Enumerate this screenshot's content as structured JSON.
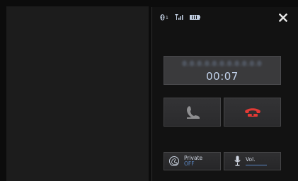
{
  "status_bar": {
    "bluetooth_icon": "bluetooth-icon",
    "bluetooth_index": "1",
    "signal_icon": "signal-strength-icon",
    "battery_icon": "battery-icon"
  },
  "close_icon": "close-icon",
  "call": {
    "caller_number": "0.0.0.0.0.0.0.0.0.0.0",
    "duration": "00:07"
  },
  "buttons": {
    "answer_icon": "phone-answer-icon",
    "end_icon": "phone-hangup-icon",
    "end_color": "#e23a35",
    "private": {
      "label": "Private",
      "state": "OFF",
      "icon": "private-mode-icon"
    },
    "volume": {
      "label": "Vol.",
      "icon": "microphone-icon"
    }
  },
  "colors": {
    "accent_blue": "#5a86c4",
    "text_light": "#c2d2ea"
  }
}
